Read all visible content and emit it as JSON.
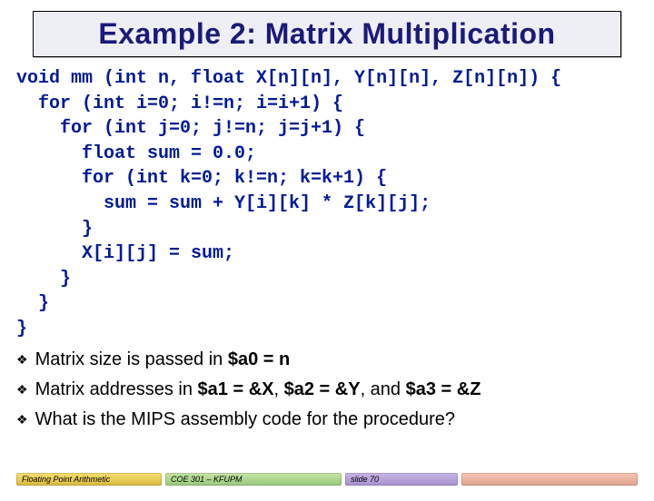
{
  "title": "Example 2: Matrix Multiplication",
  "code": "void mm (int n, float X[n][n], Y[n][n], Z[n][n]) {\n  for (int i=0; i!=n; i=i+1) {\n    for (int j=0; j!=n; j=j+1) {\n      float sum = 0.0;\n      for (int k=0; k!=n; k=k+1) {\n        sum = sum + Y[i][k] * Z[k][j];\n      }\n      X[i][j] = sum;\n    }\n  }\n}",
  "bullets": [
    {
      "prefix": "Matrix size is passed in ",
      "bold": "$a0 = n",
      "suffix": ""
    },
    {
      "prefix": "Matrix addresses in ",
      "bold": "$a1 = &X",
      "mid1": ", ",
      "bold2": "$a2 = &Y",
      "mid2": ", and ",
      "bold3": "$a3 = &Z",
      "suffix": ""
    },
    {
      "prefix": "What is the MIPS assembly code for the procedure?",
      "bold": "",
      "suffix": ""
    }
  ],
  "footer": {
    "left": "Floating Point Arithmetic",
    "mid": "COE 301 – KFUPM",
    "right": "slide 70"
  }
}
